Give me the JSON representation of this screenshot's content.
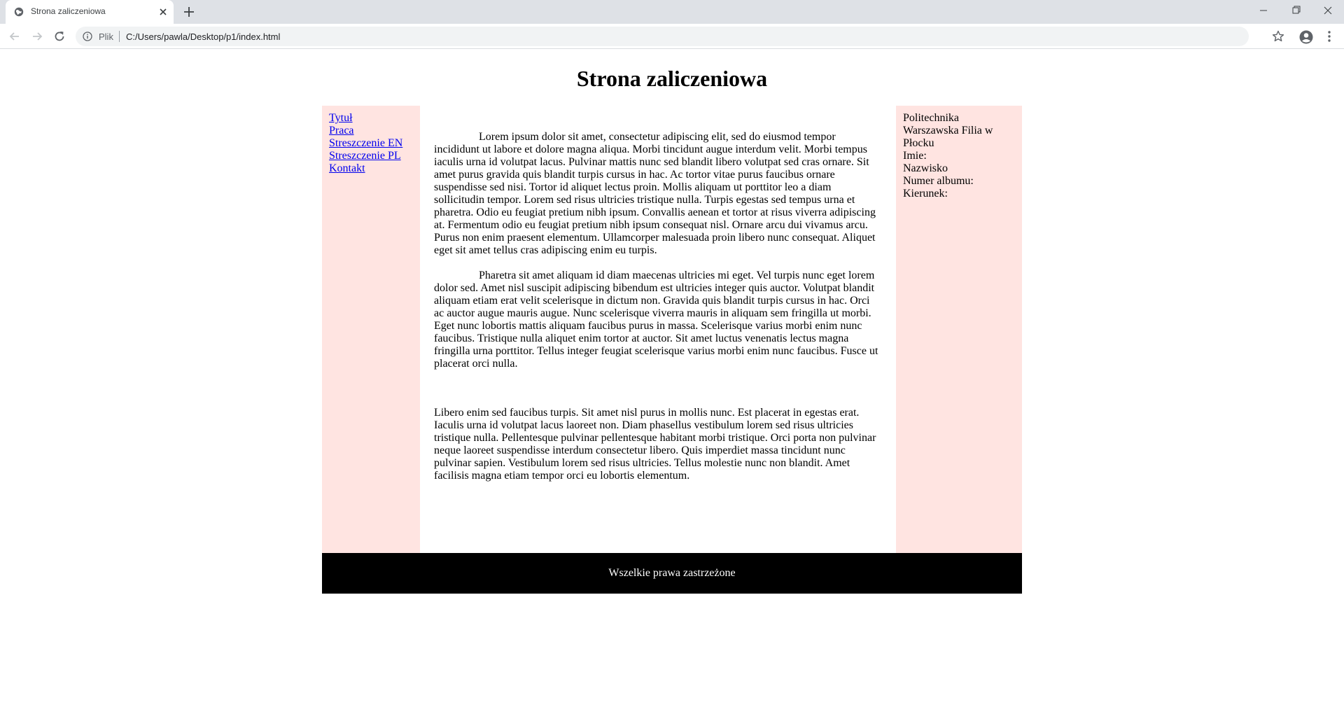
{
  "browser": {
    "tab_title": "Strona zaliczeniowa",
    "scheme_label": "Plik",
    "url": "C:/Users/pawla/Desktop/p1/index.html"
  },
  "page": {
    "title": "Strona zaliczeniowa",
    "nav": [
      "Tytuł",
      "Praca",
      "Streszczenie EN",
      "Streszczenie PL",
      "Kontakt"
    ],
    "paragraphs": [
      "Lorem ipsum dolor sit amet, consectetur adipiscing elit, sed do eiusmod tempor incididunt ut labore et dolore magna aliqua. Morbi tincidunt augue interdum velit. Morbi tempus iaculis urna id volutpat lacus. Pulvinar mattis nunc sed blandit libero volutpat sed cras ornare. Sit amet purus gravida quis blandit turpis cursus in hac. Ac tortor vitae purus faucibus ornare suspendisse sed nisi. Tortor id aliquet lectus proin. Mollis aliquam ut porttitor leo a diam sollicitudin tempor. Lorem sed risus ultricies tristique nulla. Turpis egestas sed tempus urna et pharetra. Odio eu feugiat pretium nibh ipsum. Convallis aenean et tortor at risus viverra adipiscing at. Fermentum odio eu feugiat pretium nibh ipsum consequat nisl. Ornare arcu dui vivamus arcu. Purus non enim praesent elementum. Ullamcorper malesuada proin libero nunc consequat. Aliquet eget sit amet tellus cras adipiscing enim eu turpis.",
      "Pharetra sit amet aliquam id diam maecenas ultricies mi eget. Vel turpis nunc eget lorem dolor sed. Amet nisl suscipit adipiscing bibendum est ultricies integer quis auctor. Volutpat blandit aliquam etiam erat velit scelerisque in dictum non. Gravida quis blandit turpis cursus in hac. Orci ac auctor augue mauris augue. Nunc scelerisque viverra mauris in aliquam sem fringilla ut morbi. Eget nunc lobortis mattis aliquam faucibus purus in massa. Scelerisque varius morbi enim nunc faucibus. Tristique nulla aliquet enim tortor at auctor. Sit amet luctus venenatis lectus magna fringilla urna porttitor. Tellus integer feugiat scelerisque varius morbi enim nunc faucibus. Fusce ut placerat orci nulla.",
      "Libero enim sed faucibus turpis. Sit amet nisl purus in mollis nunc. Est placerat in egestas erat. Iaculis urna id volutpat lacus laoreet non. Diam phasellus vestibulum lorem sed risus ultricies tristique nulla. Pellentesque pulvinar pellentesque habitant morbi tristique. Orci porta non pulvinar neque laoreet suspendisse interdum consectetur libero. Quis imperdiet massa tincidunt nunc pulvinar sapien. Vestibulum lorem sed risus ultricies. Tellus molestie nunc non blandit. Amet facilisis magna etiam tempor orci eu lobortis elementum."
    ],
    "info": [
      "Politechnika",
      "Warszawska Filia w",
      "Płocku",
      "Imie:",
      "Nazwisko",
      "Numer albumu:",
      "Kierunek:"
    ],
    "footer": "Wszelkie prawa zastrzeżone"
  },
  "colors": {
    "sidebar_bg": "#ffe4e1",
    "footer_bg": "#000000",
    "link": "#0000ee"
  },
  "icons": [
    "globe-icon",
    "close-icon",
    "plus-icon",
    "minimize-icon",
    "maximize-icon",
    "window-close-icon",
    "back-arrow-icon",
    "forward-arrow-icon",
    "reload-icon",
    "info-icon",
    "star-icon",
    "profile-icon",
    "menu-icon"
  ]
}
